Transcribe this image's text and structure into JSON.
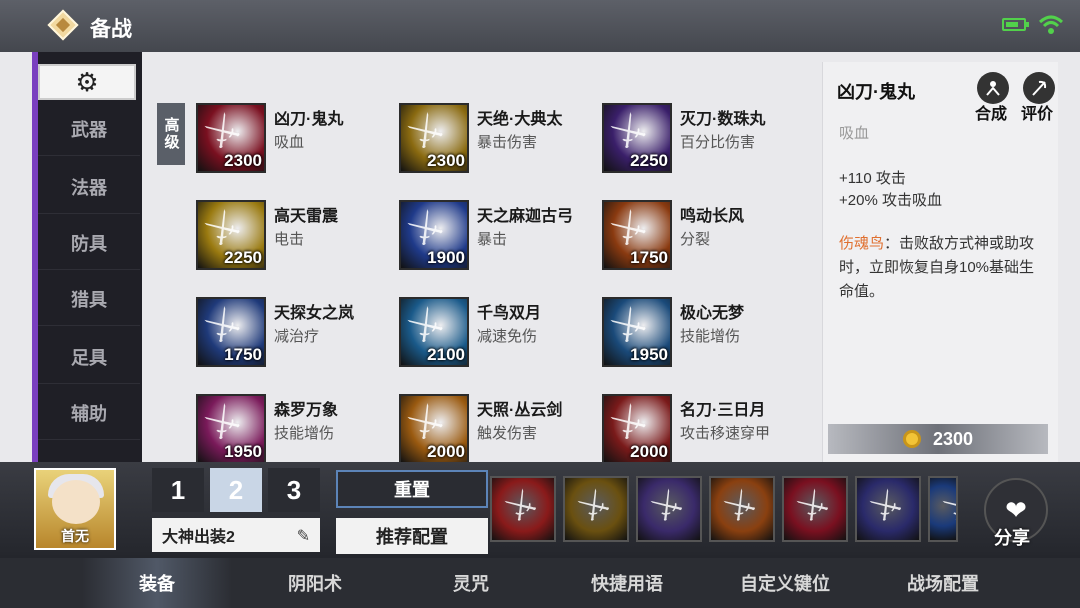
{
  "header": {
    "title": "备战",
    "logo_icon": "diamond-logo-icon",
    "battery_icon": "battery-icon",
    "wifi_icon": "wifi-icon"
  },
  "sidebar": {
    "gear_icon": "gear-icon",
    "items": [
      {
        "label": "武器",
        "active": true
      },
      {
        "label": "法器",
        "active": false
      },
      {
        "label": "防具",
        "active": false
      },
      {
        "label": "猎具",
        "active": false
      },
      {
        "label": "足具",
        "active": false
      },
      {
        "label": "辅助",
        "active": false
      }
    ]
  },
  "tier_tag": "高级",
  "items": [
    {
      "name": "凶刀·鬼丸",
      "desc": "吸血",
      "cost": "2300",
      "color": "#7a1020"
    },
    {
      "name": "天绝·大典太",
      "desc": "暴击伤害",
      "cost": "2300",
      "color": "#8a6a10"
    },
    {
      "name": "灭刀·数珠丸",
      "desc": "百分比伤害",
      "cost": "2250",
      "color": "#3a1f6a"
    },
    {
      "name": "高天雷震",
      "desc": "电击",
      "cost": "2250",
      "color": "#9a7a10"
    },
    {
      "name": "天之麻迦古弓",
      "desc": "暴击",
      "cost": "1900",
      "color": "#1f3a8a"
    },
    {
      "name": "鸣动长风",
      "desc": "分裂",
      "cost": "1750",
      "color": "#8a3a10"
    },
    {
      "name": "天探女之岚",
      "desc": "减治疗",
      "cost": "1750",
      "color": "#1f3a7a"
    },
    {
      "name": "千鸟双月",
      "desc": "减速免伤",
      "cost": "2100",
      "color": "#1a5a8a"
    },
    {
      "name": "极心无梦",
      "desc": "技能增伤",
      "cost": "1950",
      "color": "#1a4a7a"
    },
    {
      "name": "森罗万象",
      "desc": "技能增伤",
      "cost": "1950",
      "color": "#7a1a5a"
    },
    {
      "name": "天照·丛云剑",
      "desc": "触发伤害",
      "cost": "2000",
      "color": "#9a5a10"
    },
    {
      "name": "名刀·三日月",
      "desc": "攻击移速穿甲",
      "cost": "2000",
      "color": "#7a1a1a"
    }
  ],
  "detail": {
    "name": "凶刀·鬼丸",
    "subtitle": "吸血",
    "stat1": "+110 攻击",
    "stat2": "+20% 攻击吸血",
    "passive_name": "伤魂鸟",
    "passive_text": "：击败敌方式神或助攻时，立即恢复自身10%基础生命值。",
    "synth_label": "合成",
    "review_label": "评价",
    "price": "2300"
  },
  "loadout": {
    "avatar_name": "首无",
    "slots": [
      "1",
      "2",
      "3"
    ],
    "active_slot": "2",
    "loadout_name": "大神出装2",
    "reset_label": "重置",
    "recommend_label": "推荐配置",
    "share_label": "分享",
    "equipped": [
      {
        "color": "#8a1a1a",
        "icon": "blade-icon"
      },
      {
        "color": "#6a5010",
        "icon": "sword-icon"
      },
      {
        "color": "#3a2a6a",
        "icon": "boots-icon"
      },
      {
        "color": "#8a4010",
        "icon": "claw-icon"
      },
      {
        "color": "#7a1020",
        "icon": "katana-icon"
      },
      {
        "color": "#2a2a6a",
        "icon": "dagger-icon"
      },
      {
        "color": "#1a3a7a",
        "icon": "partial-item-icon"
      }
    ]
  },
  "tabs": [
    {
      "label": "装备",
      "active": true
    },
    {
      "label": "阴阳术",
      "active": false
    },
    {
      "label": "灵咒",
      "active": false
    },
    {
      "label": "快捷用语",
      "active": false
    },
    {
      "label": "自定义键位",
      "active": false
    },
    {
      "label": "战场配置",
      "active": false
    }
  ]
}
